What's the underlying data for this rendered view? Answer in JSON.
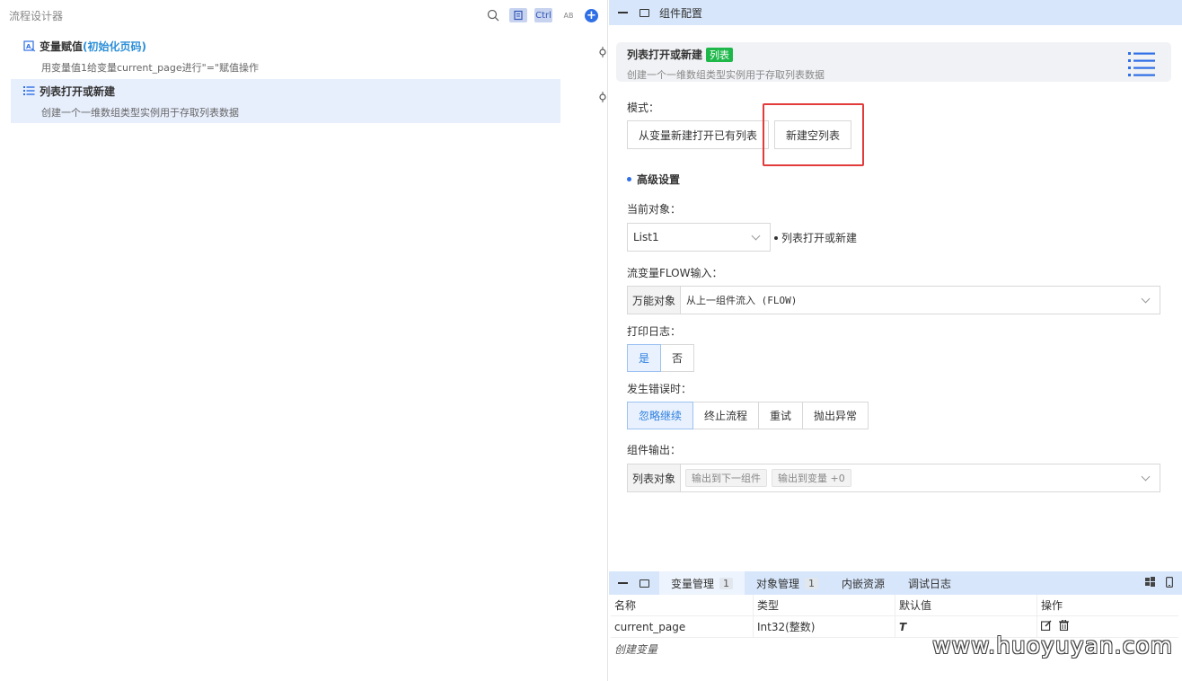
{
  "left_panel": {
    "title": "流程设计器",
    "toolbar": {
      "ctrl_label": "Ctrl",
      "abc_label": "AB",
      "add_label": "+"
    },
    "items": [
      {
        "title_main": "变量赋值",
        "title_highlight": "(初始化页码)",
        "desc": "用变量值1给变量current_page进行\"=\"赋值操作"
      },
      {
        "title_main": "列表打开或新建",
        "title_highlight": "",
        "desc": "创建一个一维数组类型实例用于存取列表数据"
      }
    ]
  },
  "config_panel": {
    "title": "组件配置",
    "component": {
      "name": "列表打开或新建",
      "tag": "列表",
      "desc": "创建一个一维数组类型实例用于存取列表数据"
    },
    "mode": {
      "label": "模式：",
      "options": [
        "从变量新建打开已有列表",
        "新建空列表"
      ],
      "selected": "新建空列表"
    },
    "advanced": {
      "title": "高级设置"
    },
    "current_object": {
      "label": "当前对象：",
      "value": "List1",
      "note": "列表打开或新建"
    },
    "flow_input": {
      "label": "流变量FLOW输入：",
      "prefix": "万能对象",
      "value": "从上一组件流入 (FLOW)"
    },
    "print_log": {
      "label": "打印日志：",
      "options": [
        "是",
        "否"
      ],
      "selected": "是"
    },
    "on_error": {
      "label": "发生错误时：",
      "options": [
        "忽略继续",
        "终止流程",
        "重试",
        "抛出异常"
      ],
      "selected": "忽略继续"
    },
    "output": {
      "label": "组件输出：",
      "prefix": "列表对象",
      "chips": [
        "输出到下一组件",
        "输出到变量 +0"
      ]
    }
  },
  "bottom_panel": {
    "tabs": [
      {
        "label": "变量管理",
        "count": "1"
      },
      {
        "label": "对象管理",
        "count": "1"
      },
      {
        "label": "内嵌资源",
        "count": ""
      },
      {
        "label": "调试日志",
        "count": ""
      }
    ],
    "table": {
      "headers": [
        "名称",
        "类型",
        "默认值",
        "操作"
      ],
      "rows": [
        {
          "name": "current_page",
          "type": "Int32(整数)",
          "default": "T"
        }
      ],
      "create_label": "创建变量"
    },
    "watermark": "www.huoyuyan.com"
  },
  "colors": {
    "accent": "#2f6fe6",
    "header_bg": "#d7e6fa",
    "tag_green": "#1eb84a",
    "highlight_red": "#e23b3b"
  }
}
